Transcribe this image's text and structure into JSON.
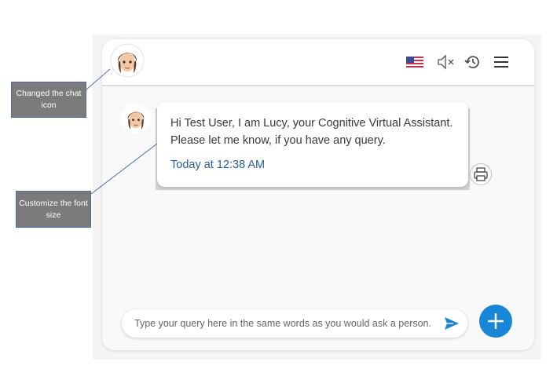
{
  "annotations": [
    {
      "label": "Changed the chat icon"
    },
    {
      "label": "Customize the font size"
    }
  ],
  "header": {
    "icons": [
      "us-flag-icon",
      "mute-icon",
      "history-icon",
      "menu-icon"
    ]
  },
  "chat": {
    "message": "Hi Test User, I am Lucy, your Cognitive Virtual Assistant. Please let me know, if you have any query.",
    "timestamp": "Today at 12:38 AM"
  },
  "composer": {
    "placeholder": "Type your query here in the same words as you would ask a person."
  },
  "colors": {
    "accent": "#1a86d8",
    "timestamp": "#2a5d9a",
    "annotation_bg": "#7b7b7b",
    "annotation_border": "#4b6fa5"
  }
}
